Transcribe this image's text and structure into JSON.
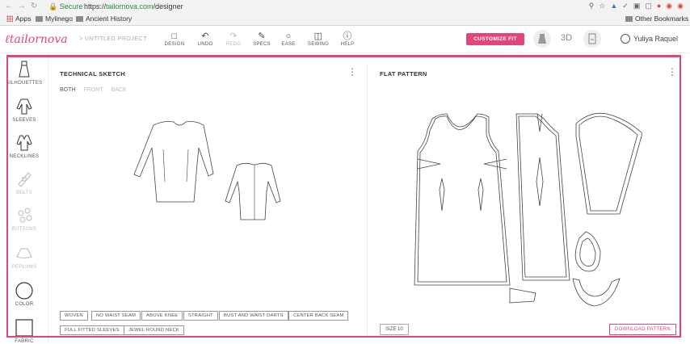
{
  "browser": {
    "secure_label": "Secure",
    "url_scheme": "https://",
    "url_host": "tailornova.com",
    "url_path": "/designer",
    "bookmarks": [
      "Apps",
      "Mylinego",
      "Ancient History"
    ],
    "other_bookmarks": "Other Bookmarks"
  },
  "header": {
    "logo": "tailornova",
    "project": "> UNTITLED PROJECT",
    "tools": [
      "DESIGN",
      "UNDO",
      "REDO",
      "SPECS",
      "EASE",
      "SEWING",
      "HELP"
    ],
    "customize_fit": "CUSTOMIZE FIT",
    "view_3d": "3D",
    "user_name": "Yuliya Raquel"
  },
  "sidebar": {
    "items": [
      "SILHOUETTES",
      "SLEEVES",
      "NECKLINES",
      "BELTS",
      "BUTTONS",
      "PEPLUMS",
      "COLOR",
      "FABRIC"
    ]
  },
  "technical": {
    "title": "TECHNICAL SKETCH",
    "views": [
      "BOTH",
      "FRONT",
      "BACK"
    ],
    "tags": [
      "WOVEN",
      "NO WAIST SEAM",
      "ABOVE KNEE",
      "STRAIGHT",
      "BUST AND WAIST DARTS",
      "CENTER BACK SEAM",
      "FULL FITTED SLEEVES",
      "JEWEL ROUND NECK"
    ]
  },
  "flat": {
    "title": "FLAT PATTERN",
    "size": "SIZE 10",
    "download": "DOWNLOAD PATTERN"
  },
  "colors": {
    "accent": "#e0457b"
  }
}
